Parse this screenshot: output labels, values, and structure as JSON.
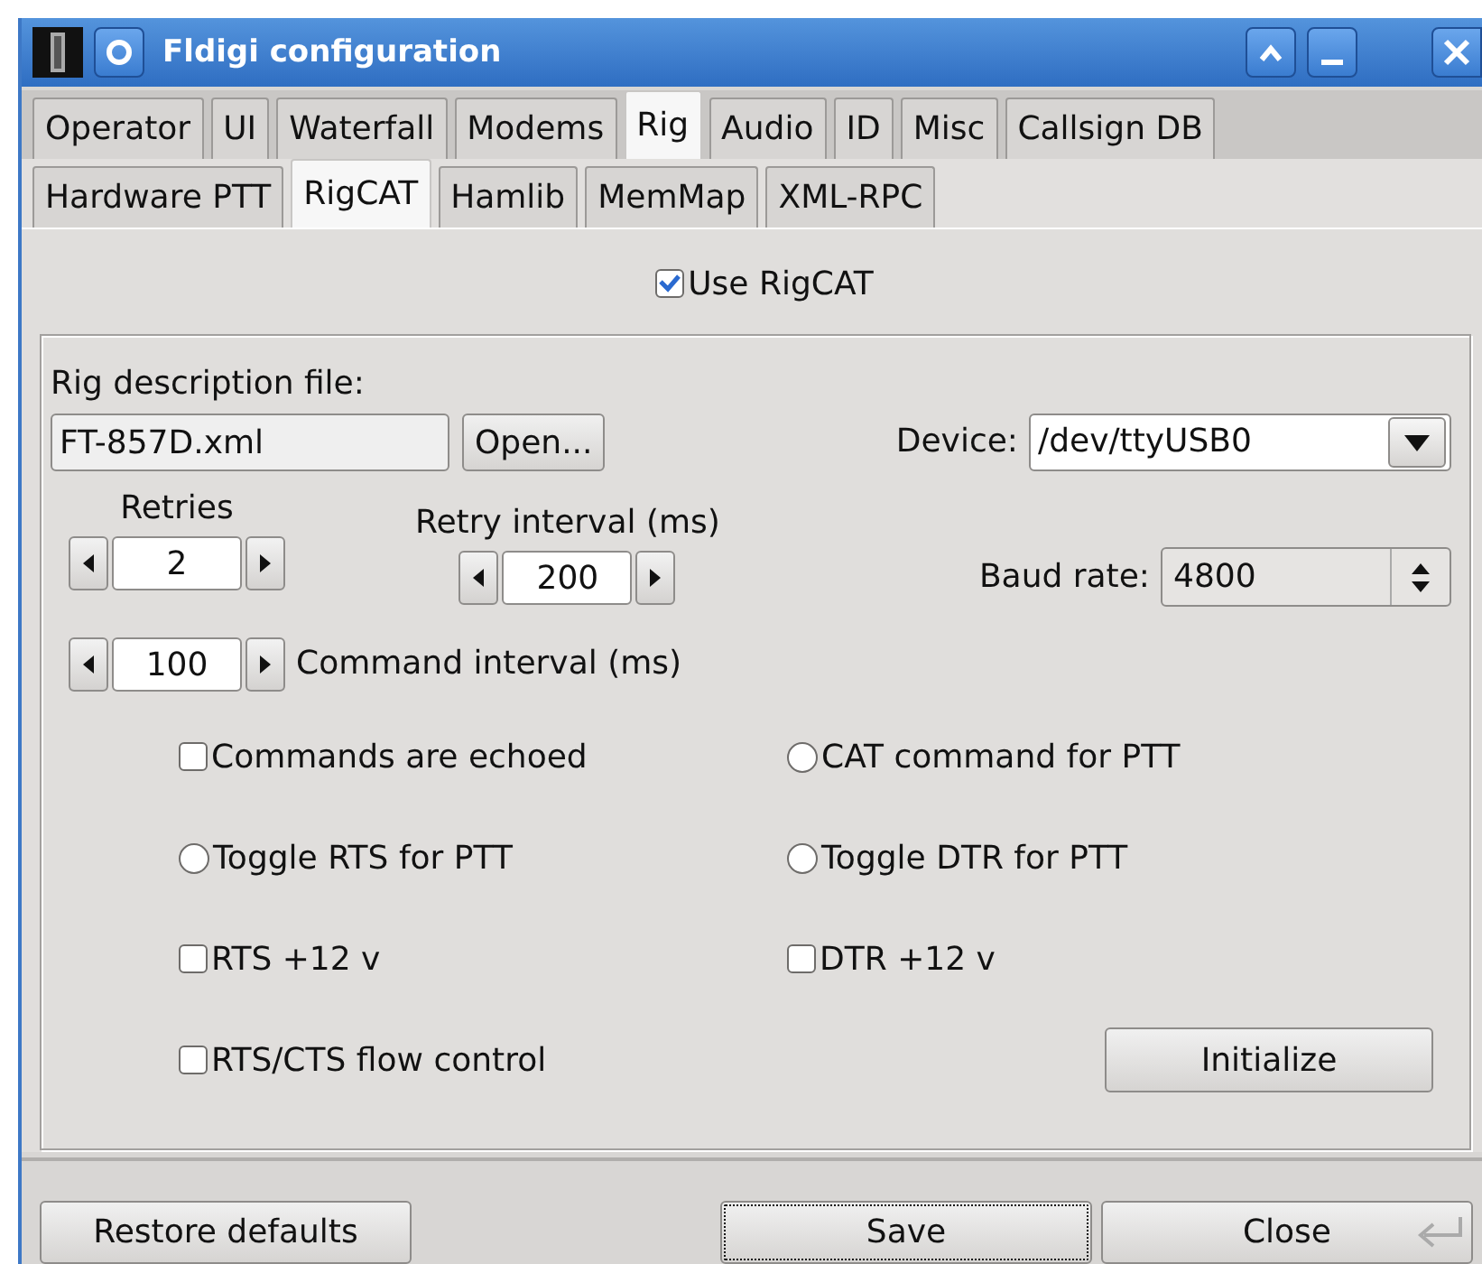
{
  "window": {
    "title": "Fldigi configuration"
  },
  "tabs": [
    {
      "label": "Operator",
      "selected": false
    },
    {
      "label": "UI",
      "selected": false
    },
    {
      "label": "Waterfall",
      "selected": false
    },
    {
      "label": "Modems",
      "selected": false
    },
    {
      "label": "Rig",
      "selected": true
    },
    {
      "label": "Audio",
      "selected": false
    },
    {
      "label": "ID",
      "selected": false
    },
    {
      "label": "Misc",
      "selected": false
    },
    {
      "label": "Callsign DB",
      "selected": false
    }
  ],
  "subtabs": [
    {
      "label": "Hardware PTT",
      "selected": false
    },
    {
      "label": "RigCAT",
      "selected": true
    },
    {
      "label": "Hamlib",
      "selected": false
    },
    {
      "label": "MemMap",
      "selected": false
    },
    {
      "label": "XML-RPC",
      "selected": false
    }
  ],
  "use_rigcat": {
    "label": "Use RigCAT",
    "checked": true
  },
  "rig_file": {
    "label": "Rig description file:",
    "value": "FT-857D.xml",
    "button": "Open..."
  },
  "device": {
    "label": "Device:",
    "value": "/dev/ttyUSB0"
  },
  "retries": {
    "label": "Retries",
    "value": "2"
  },
  "retry_interval": {
    "label": "Retry interval (ms)",
    "value": "200"
  },
  "baud_rate": {
    "label": "Baud rate:",
    "value": "4800"
  },
  "command_interval": {
    "label": "Command interval (ms)",
    "value": "100"
  },
  "options": [
    {
      "kind": "checkbox",
      "label": "Commands are echoed",
      "checked": false
    },
    {
      "kind": "radio",
      "label": "CAT command for PTT",
      "checked": false
    },
    {
      "kind": "radio",
      "label": "Toggle RTS for PTT",
      "checked": false
    },
    {
      "kind": "radio",
      "label": "Toggle DTR for PTT",
      "checked": false
    },
    {
      "kind": "checkbox",
      "label": "RTS +12 v",
      "checked": false
    },
    {
      "kind": "checkbox",
      "label": "DTR +12 v",
      "checked": false
    },
    {
      "kind": "checkbox",
      "label": "RTS/CTS flow control",
      "checked": false
    }
  ],
  "initialize_button": "Initialize",
  "footer_buttons": [
    {
      "label": "Restore defaults",
      "focused": false,
      "default": false
    },
    {
      "label": "Save",
      "focused": true,
      "default": false
    },
    {
      "label": "Close",
      "focused": false,
      "default": true
    }
  ]
}
